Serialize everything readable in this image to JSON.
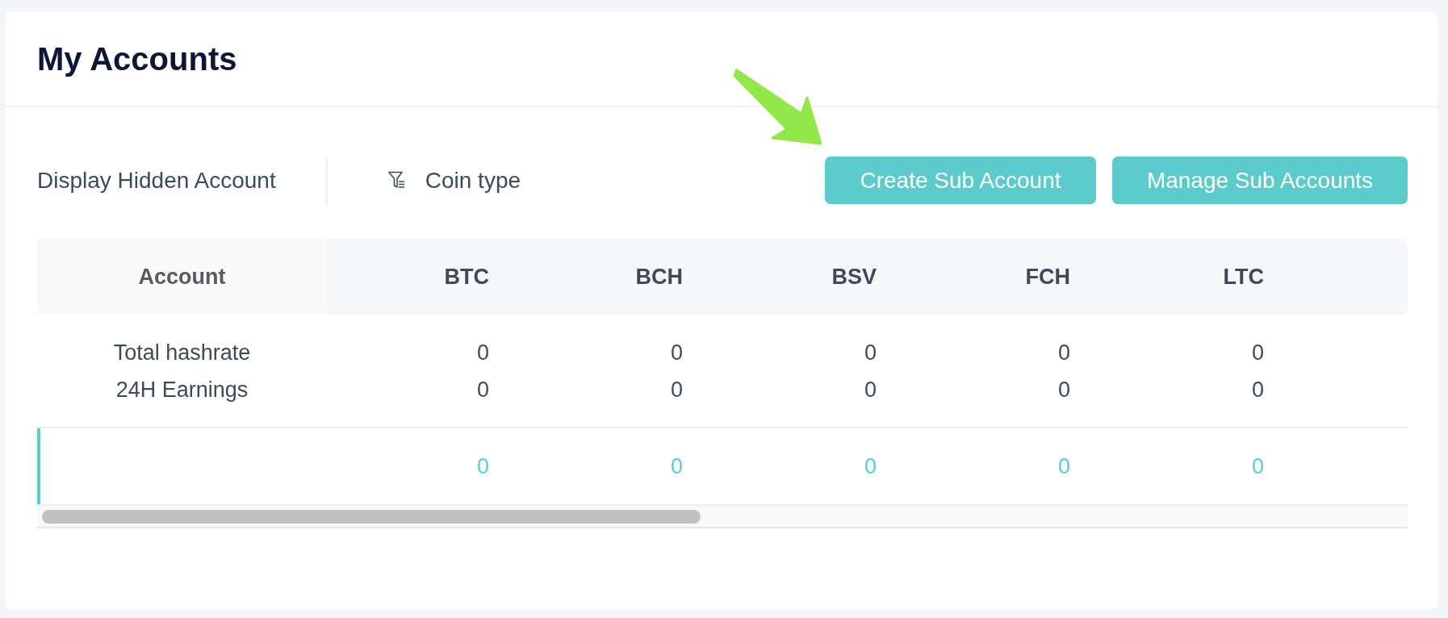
{
  "header": {
    "title": "My Accounts"
  },
  "toolbar": {
    "hidden_accounts_toggle": {
      "label": "Display Hidden Account"
    },
    "coin_filter": {
      "label": "Coin type"
    },
    "buttons": [
      {
        "label": "Create Sub Account"
      },
      {
        "label": "Manage Sub Accounts"
      }
    ]
  },
  "table": {
    "columns": [
      "Account",
      "BTC",
      "BCH",
      "BSV",
      "FCH",
      "LTC"
    ],
    "rows": [
      {
        "kind": "summary",
        "selected": false,
        "lines": [
          {
            "label": "Total hashrate",
            "values": [
              "0",
              "0",
              "0",
              "0",
              "0"
            ]
          },
          {
            "label": "24H Earnings",
            "values": [
              "0",
              "0",
              "0",
              "0",
              "0"
            ]
          }
        ]
      },
      {
        "kind": "account",
        "selected": true,
        "values": [
          "0",
          "0",
          "0",
          "0",
          "0"
        ]
      }
    ]
  }
}
